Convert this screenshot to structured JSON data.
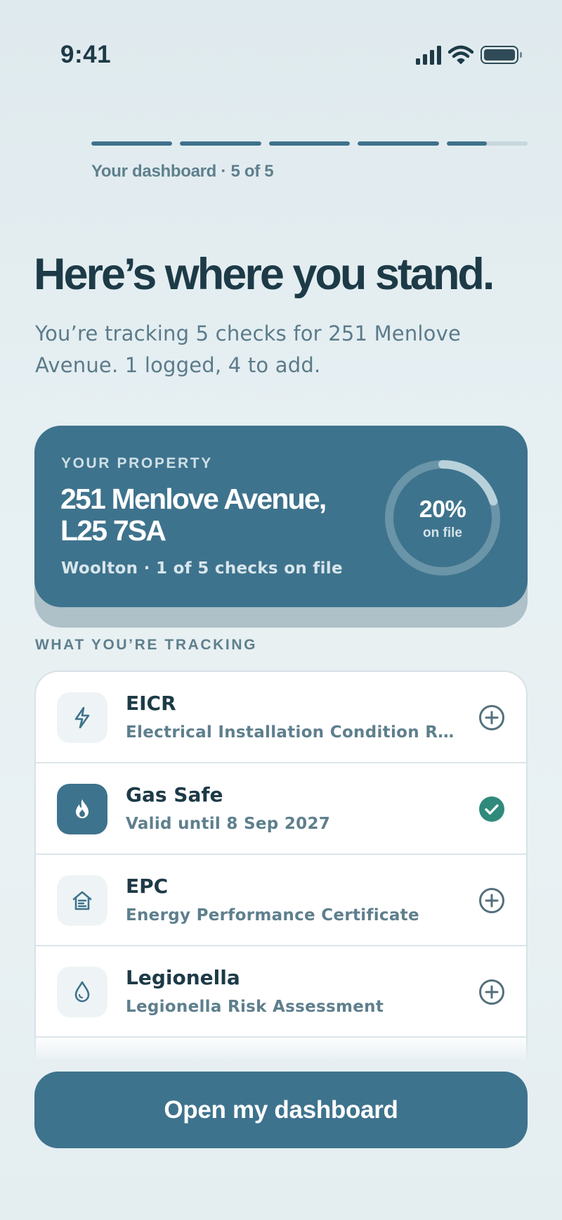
{
  "status_bar": {
    "time": "9:41"
  },
  "progress": {
    "label": "Your dashboard · 5 of 5",
    "segments": [
      1,
      1,
      1,
      1,
      0.5
    ]
  },
  "header": {
    "title": "Here’s where you stand.",
    "subtitle": "You’re tracking 5 checks for 251 Menlove Avenue. 1 logged, 4 to add."
  },
  "property_card": {
    "eyebrow": "YOUR PROPERTY",
    "address": "251 Menlove Avenue, L25 7SA",
    "meta": "Woolton · 1 of 5 checks on file",
    "ring_value": "20%",
    "ring_fraction": 0.2,
    "ring_caption": "on file"
  },
  "tracking": {
    "section_label": "WHAT YOU’RE TRACKING",
    "items": [
      {
        "title": "EICR",
        "subtitle": "Electrical Installation Condition Rep...",
        "icon": "bolt-icon",
        "status": "add"
      },
      {
        "title": "Gas Safe",
        "subtitle": "Valid until 8 Sep 2027",
        "icon": "flame-icon",
        "status": "done"
      },
      {
        "title": "EPC",
        "subtitle": "Energy Performance Certificate",
        "icon": "house-icon",
        "status": "add"
      },
      {
        "title": "Legionella",
        "subtitle": "Legionella Risk Assessment",
        "icon": "water-drop-icon",
        "status": "add"
      }
    ]
  },
  "cta": {
    "label": "Open my dashboard"
  },
  "colors": {
    "brand": "#3e738d",
    "ink": "#1d3a47",
    "muted": "#5e7f8d",
    "success": "#2f8a7c"
  }
}
